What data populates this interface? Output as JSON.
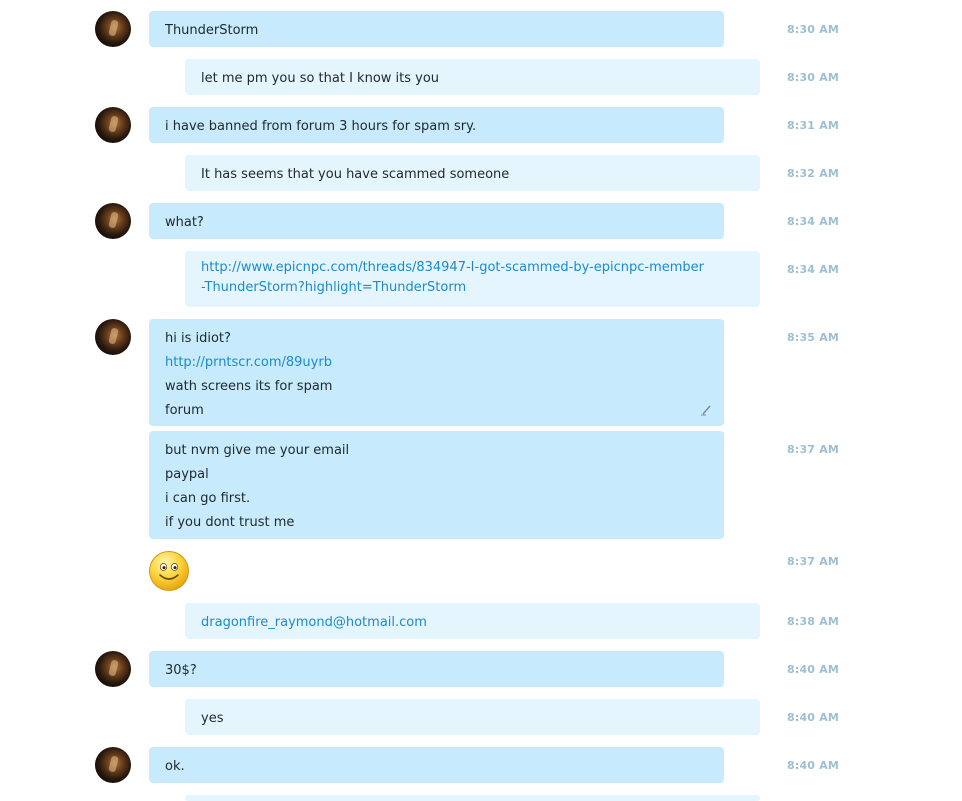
{
  "messages": [
    {
      "side": "in",
      "avatar": true,
      "lines": [
        "ThunderStorm"
      ],
      "time": "8:30 AM"
    },
    {
      "side": "out",
      "avatar": false,
      "lines": [
        "let me pm you so that I know its you"
      ],
      "time": "8:30 AM"
    },
    {
      "side": "in",
      "avatar": true,
      "lines": [
        "i have banned from forum 3 hours for spam sry."
      ],
      "time": "8:31 AM"
    },
    {
      "side": "out",
      "avatar": false,
      "lines": [
        "It has seems that you have scammed someone"
      ],
      "time": "8:32 AM"
    },
    {
      "side": "in",
      "avatar": true,
      "lines": [
        "what?"
      ],
      "time": "8:34 AM"
    },
    {
      "side": "out",
      "avatar": false,
      "link_lines": [
        "http://www.epicnpc.com/threads/834947-I-got-scammed-by-epicnpc-member",
        "-ThunderStorm?highlight=ThunderStorm"
      ],
      "time": "8:34 AM"
    },
    {
      "side": "in",
      "avatar": true,
      "lines": [
        "hi is idiot?",
        "http://prntscr.com/89uyrb",
        "wath screens its for spam",
        "forum"
      ],
      "time": "8:35 AM",
      "edited": true
    },
    {
      "side": "in",
      "avatar": false,
      "lines": [
        "but nvm give me your email",
        "paypal",
        "i can go first.",
        "if you dont trust me"
      ],
      "time": "8:37 AM"
    },
    {
      "side": "in",
      "avatar": false,
      "emoticon": "smile-emoticon",
      "time": "8:37 AM"
    },
    {
      "side": "out",
      "avatar": false,
      "link_lines": [
        "dragonfire_raymond@hotmail.com"
      ],
      "time": "8:38 AM"
    },
    {
      "side": "in",
      "avatar": true,
      "lines": [
        "30$?"
      ],
      "time": "8:40 AM"
    },
    {
      "side": "out",
      "avatar": false,
      "lines": [
        "yes"
      ],
      "time": "8:40 AM"
    },
    {
      "side": "in",
      "avatar": true,
      "lines": [
        "ok."
      ],
      "time": "8:40 AM"
    }
  ],
  "colors": {
    "incoming_bubble": "#c7eafc",
    "outgoing_bubble": "#e5f5fd",
    "link": "#1b8bcb",
    "timestamp": "#9ebfd3"
  }
}
